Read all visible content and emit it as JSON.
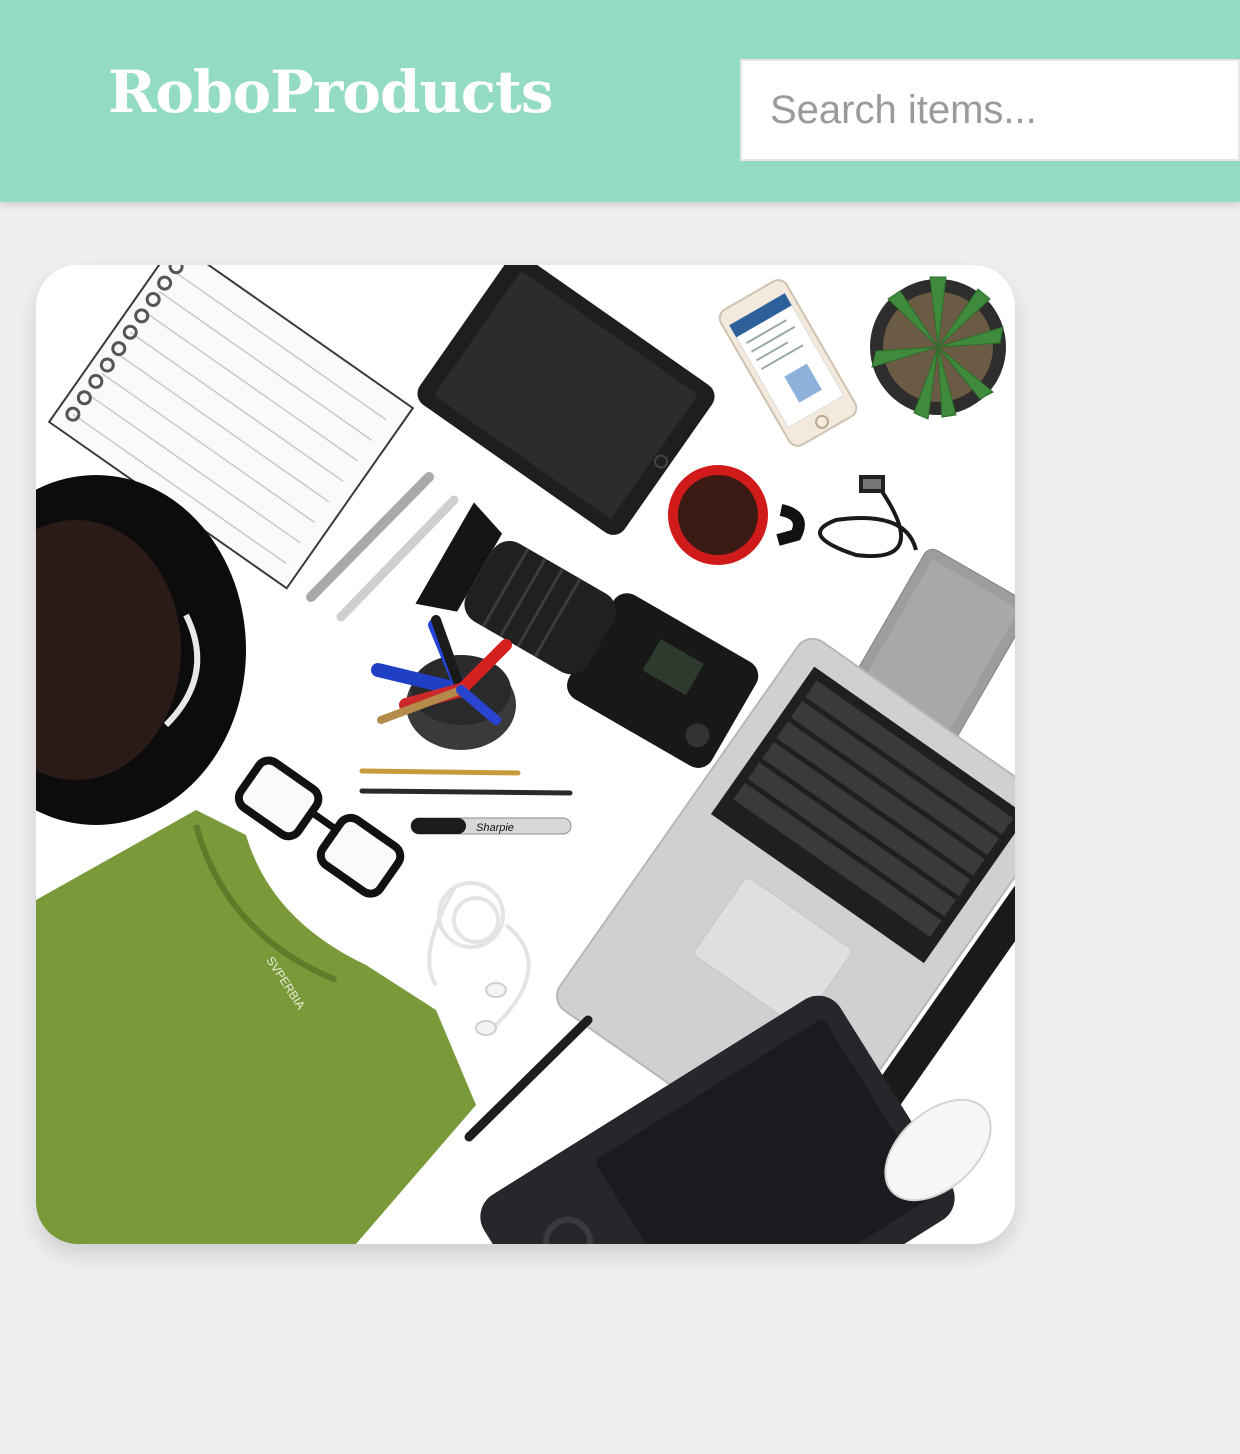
{
  "header": {
    "brand": "RoboProducts",
    "search_placeholder": "Search items...",
    "search_value": ""
  },
  "colors": {
    "header_bg": "#94dbc3",
    "page_bg": "#efefef",
    "brand_text": "#ffffff"
  },
  "product_card": {
    "image_alt": "Flat lay of gadgets and accessories",
    "items": [
      "notebook",
      "tablet",
      "smartphone",
      "succulent",
      "hat",
      "pens",
      "coffee-mug",
      "usb-cable",
      "hard-drive",
      "camera",
      "pen-holder",
      "laptop",
      "glasses",
      "pencils",
      "marker",
      "earphones",
      "t-shirt",
      "drawing-tablet",
      "mouse"
    ],
    "pictured_text": {
      "marker_brand": "Sharpie",
      "shirt_label": "SVPERBIA"
    }
  }
}
